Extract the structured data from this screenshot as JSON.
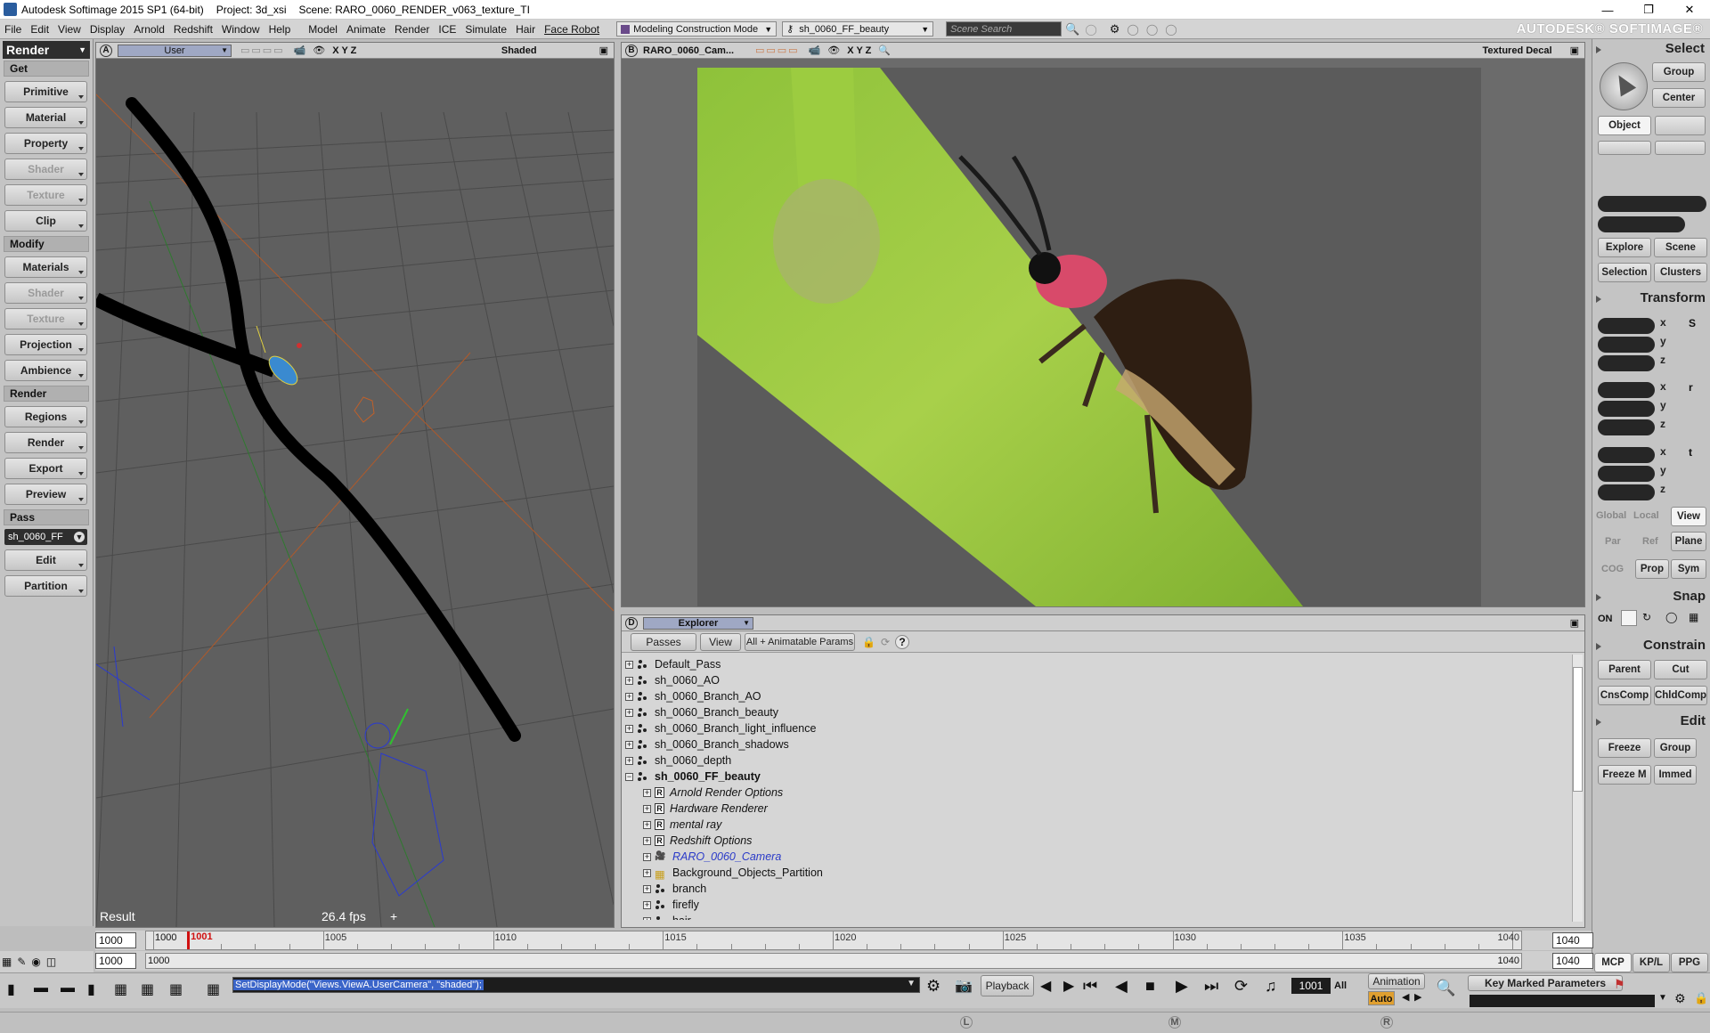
{
  "window": {
    "title": "Autodesk Softimage 2015 SP1 (64-bit)",
    "project": "Project: 3d_xsi",
    "scene": "Scene: RARO_0060_RENDER_v063_texture_TI"
  },
  "menu": {
    "items": [
      "File",
      "Edit",
      "View",
      "Display",
      "Arnold",
      "Redshift",
      "Window",
      "Help",
      "Model",
      "Animate",
      "Render",
      "ICE",
      "Simulate",
      "Hair",
      "Face Robot"
    ],
    "mode": "Modeling Construction Mode",
    "pass": "sh_0060_FF_beauty",
    "search_placeholder": "Scene Search",
    "brand": "AUTODESK® SOFTIMAGE®"
  },
  "left_panel": {
    "module": "Render",
    "get_header": "Get",
    "get_buttons": [
      "Primitive",
      "Material",
      "Property",
      "Shader",
      "Texture",
      "Clip"
    ],
    "modify_header": "Modify",
    "modify_buttons": [
      "Materials",
      "Shader",
      "Texture",
      "Projection",
      "Ambience"
    ],
    "render_header": "Render",
    "render_buttons": [
      "Regions",
      "Render",
      "Export",
      "Preview"
    ],
    "pass_header": "Pass",
    "pass_value": "sh_0060_FF",
    "pass_buttons": [
      "Edit",
      "Partition"
    ]
  },
  "viewport_a": {
    "letter": "A",
    "camera": "User",
    "axes": "X Y Z",
    "mode": "Shaded",
    "result_label": "Result",
    "fps": "26.4 fps",
    "fps_suffix": "+"
  },
  "viewport_b": {
    "letter": "B",
    "camera": "RARO_0060_Cam...",
    "axes": "X Y Z",
    "mode": "Textured Decal"
  },
  "explorer": {
    "letter": "D",
    "title": "Explorer",
    "passes_btn": "Passes",
    "view_btn": "View",
    "filter_btn": "All + Animatable Params",
    "help": "?",
    "tree": [
      {
        "label": "Default_Pass",
        "level": 0,
        "icon": "pass",
        "style": "normal"
      },
      {
        "label": "sh_0060_AO",
        "level": 0,
        "icon": "pass",
        "style": "normal"
      },
      {
        "label": "sh_0060_Branch_AO",
        "level": 0,
        "icon": "pass",
        "style": "normal"
      },
      {
        "label": "sh_0060_Branch_beauty",
        "level": 0,
        "icon": "pass",
        "style": "normal"
      },
      {
        "label": "sh_0060_Branch_light_influence",
        "level": 0,
        "icon": "pass",
        "style": "normal"
      },
      {
        "label": "sh_0060_Branch_shadows",
        "level": 0,
        "icon": "pass",
        "style": "normal"
      },
      {
        "label": "sh_0060_depth",
        "level": 0,
        "icon": "pass",
        "style": "normal"
      },
      {
        "label": "sh_0060_FF_beauty",
        "level": 0,
        "icon": "pass",
        "style": "bold",
        "expanded": true
      },
      {
        "label": "Arnold Render Options",
        "level": 1,
        "icon": "R",
        "style": "italic"
      },
      {
        "label": "Hardware Renderer",
        "level": 1,
        "icon": "R",
        "style": "italic"
      },
      {
        "label": "mental ray",
        "level": 1,
        "icon": "R",
        "style": "italic"
      },
      {
        "label": "Redshift Options",
        "level": 1,
        "icon": "R",
        "style": "italic"
      },
      {
        "label": "RARO_0060_Camera",
        "level": 1,
        "icon": "camera",
        "style": "link"
      },
      {
        "label": "Background_Objects_Partition",
        "level": 1,
        "icon": "partition",
        "style": "normal"
      },
      {
        "label": "branch",
        "level": 1,
        "icon": "pass",
        "style": "normal"
      },
      {
        "label": "firefly",
        "level": 1,
        "icon": "pass",
        "style": "normal"
      },
      {
        "label": "hair",
        "level": 1,
        "icon": "pass",
        "style": "normal"
      }
    ]
  },
  "right_panel": {
    "select_header": "Select",
    "select_buttons": {
      "group": "Group",
      "center": "Center",
      "object": "Object"
    },
    "explore": "Explore",
    "scene": "Scene",
    "selection": "Selection",
    "clusters": "Clusters",
    "transform_header": "Transform",
    "axes": [
      "x",
      "y",
      "z"
    ],
    "ref_row1": [
      "Global",
      "Local",
      "View"
    ],
    "ref_row2": [
      "Par",
      "Ref",
      "Plane"
    ],
    "ref_row3": [
      "COG",
      "Prop",
      "Sym"
    ],
    "snap_header": "Snap",
    "snap_on": "ON",
    "constrain_header": "Constrain",
    "constrain_buttons": [
      "Parent",
      "Cut",
      "CnsComp",
      "ChldComp"
    ],
    "edit_header": "Edit",
    "edit_buttons": [
      "Freeze",
      "Group",
      "Freeze M",
      "Immed"
    ],
    "tabs": [
      "MCP",
      "KP/L",
      "PPG"
    ]
  },
  "timeline": {
    "start_outer": "1000",
    "start_inner": "1000",
    "range_start_lbl": "1000",
    "range_start_inner": "1000",
    "current_frame": "1001",
    "ticks": [
      "1000",
      "1005",
      "1010",
      "1015",
      "1020",
      "1025",
      "1030",
      "1035"
    ],
    "end_inner": "1040",
    "end_outer": "1040",
    "range_end_lbl": "1040",
    "range_end": "1040"
  },
  "command_bar": {
    "command": "SetDisplayMode(\"Views.ViewA.UserCamera\", \"shaded\");",
    "playback": "Playback",
    "frame": "1001",
    "all": "All",
    "animation": "Animation",
    "auto": "Auto",
    "key_marked": "Key Marked Parameters",
    "mouse_l": "L",
    "mouse_m": "M",
    "mouse_r": "R"
  }
}
